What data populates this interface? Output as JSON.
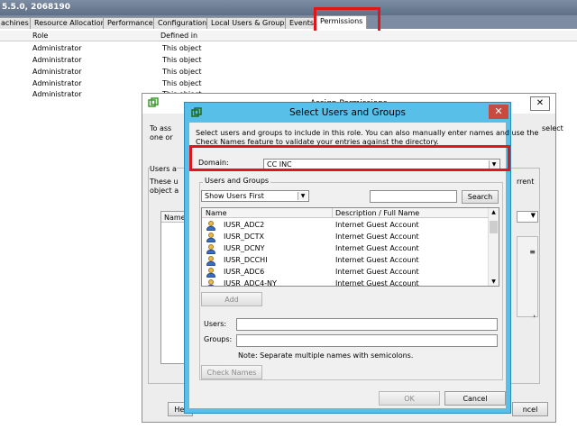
{
  "window": {
    "title": "5.5.0, 2068190"
  },
  "tabs": [
    "achines",
    "Resource Allocation",
    "Performance",
    "Configuration",
    "Local Users & Groups",
    "Events",
    "Permissions"
  ],
  "grid": {
    "columns": [
      "Role",
      "Defined in"
    ],
    "rows": [
      {
        "role": "Administrator",
        "defined": "This object"
      },
      {
        "role": "Administrator",
        "defined": "This object"
      },
      {
        "role": "Administrator",
        "defined": "This object"
      },
      {
        "role": "Administrator",
        "defined": "This object"
      },
      {
        "role": "Administrator",
        "defined": "This object"
      }
    ]
  },
  "back_dialog": {
    "title": "Assign Permissions",
    "intro_left": "To ass",
    "intro_left2": "one or",
    "intro_right": "select",
    "users_label": "Users a",
    "these_label": "These u",
    "object_label": "object a",
    "current_label": "rrent",
    "name_col": "Name",
    "help_label": "Hel",
    "cancel_label": "ncel"
  },
  "dialog": {
    "title": "Select Users and Groups",
    "instructions": [
      "Select users and groups to include in this role. You can also manually enter names and use the",
      "Check Names feature to validate your entries against the directory."
    ],
    "domain_label": "Domain:",
    "domain_value": "CC INC",
    "group_label": "Users and Groups",
    "filter_value": "Show Users First",
    "search_value": "",
    "search_button": "Search",
    "list_columns": [
      "Name",
      "Description / Full Name"
    ],
    "list_rows": [
      {
        "name": "IUSR_ADC2",
        "desc": "Internet Guest Account"
      },
      {
        "name": "IUSR_DCTX",
        "desc": "Internet Guest Account"
      },
      {
        "name": "IUSR_DCNY",
        "desc": "Internet Guest Account"
      },
      {
        "name": "IUSR_DCCHI",
        "desc": "Internet Guest Account"
      },
      {
        "name": "IUSR_ADC6",
        "desc": "Internet Guest Account"
      },
      {
        "name": "IUSR_ADC4-NY",
        "desc": "Internet Guest Account"
      }
    ],
    "add_button": "Add",
    "users_label": "Users:",
    "users_value": "",
    "groups_label": "Groups:",
    "groups_value": "",
    "note": "Note: Separate multiple names with semicolons.",
    "check_names_button": "Check Names",
    "ok_button": "OK",
    "cancel_button": "Cancel"
  },
  "colors": {
    "highlight": "#e0161b",
    "dialog_frame": "#58c0e8",
    "close": "#c94b3f"
  },
  "icons": {
    "user": "user-icon",
    "vsphere": "vsphere-icon",
    "close": "close-icon"
  }
}
